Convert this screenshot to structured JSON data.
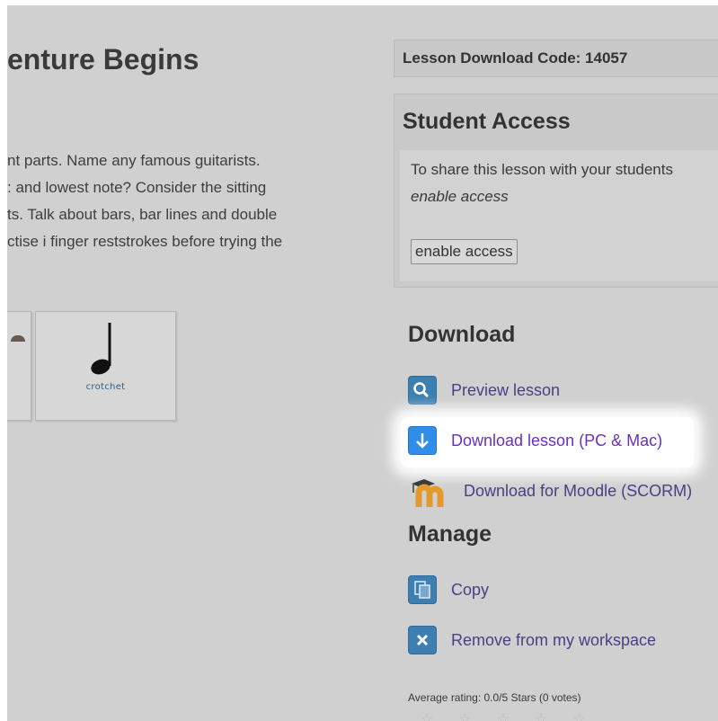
{
  "lesson": {
    "title": "enture Begins",
    "description_lines": [
      "nt parts. Name any famous guitarists.",
      ": and lowest note? Consider the sitting",
      "ts. Talk about bars, bar lines and double",
      "ctise i finger reststrokes before trying the"
    ],
    "card_caption": "crotchet"
  },
  "download_code": {
    "text": "Lesson Download Code: 14057"
  },
  "student_access": {
    "heading": "Student Access",
    "line1": "To share this lesson with your students",
    "line2": "enable access",
    "button": "enable access"
  },
  "download": {
    "heading": "Download",
    "items": [
      {
        "label": "Preview lesson",
        "icon": "magnifier-icon"
      },
      {
        "label": "Download lesson (PC & Mac)",
        "icon": "download-arrow-icon"
      },
      {
        "label": "Download for Moodle (SCORM)",
        "icon": "moodle-icon"
      }
    ]
  },
  "manage": {
    "heading": "Manage",
    "items": [
      {
        "label": "Copy",
        "icon": "copy-icon"
      },
      {
        "label": "Remove from my workspace",
        "icon": "remove-x-icon"
      }
    ]
  },
  "rating": {
    "text": "Average rating: 0.0/5 Stars (0 votes)"
  },
  "colors": {
    "link": "#4a3f86",
    "highlight_link": "#6a2fc4",
    "icon_blue": "#3c7fb0",
    "download_blue": "#2f8fe8"
  }
}
